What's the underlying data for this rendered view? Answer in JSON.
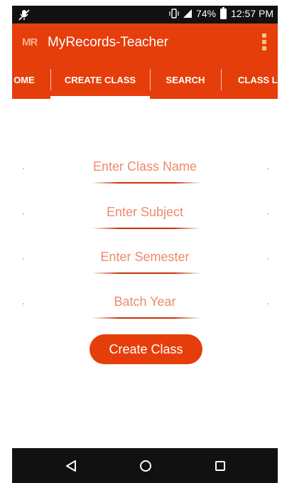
{
  "status_bar": {
    "battery": "74%",
    "time": "12:57 PM"
  },
  "app_bar": {
    "logo": "MR",
    "title": "MyRecords-Teacher",
    "menu_icon": "overflow-menu-icon"
  },
  "tabs": [
    {
      "label": "HOME",
      "shown": "OME",
      "active": false
    },
    {
      "label": "CREATE CLASS",
      "shown": "CREATE CLASS",
      "active": true
    },
    {
      "label": "SEARCH",
      "shown": "SEARCH",
      "active": false
    },
    {
      "label": "CLASS LIST",
      "shown": "CLASS LIS",
      "active": false
    }
  ],
  "form": {
    "class_name": {
      "placeholder": "Enter Class Name",
      "value": ""
    },
    "subject": {
      "placeholder": "Enter Subject",
      "value": ""
    },
    "semester": {
      "placeholder": "Enter Semester",
      "value": ""
    },
    "batch_year": {
      "placeholder": "Batch Year",
      "value": ""
    },
    "submit_label": "Create Class"
  },
  "navigation": {
    "back_icon": "back-triangle-icon",
    "home_icon": "home-circle-icon",
    "recents_icon": "recents-square-icon"
  },
  "colors": {
    "accent": "#e63e0b",
    "placeholder": "#ef8a6a",
    "system_bars": "#111111"
  }
}
